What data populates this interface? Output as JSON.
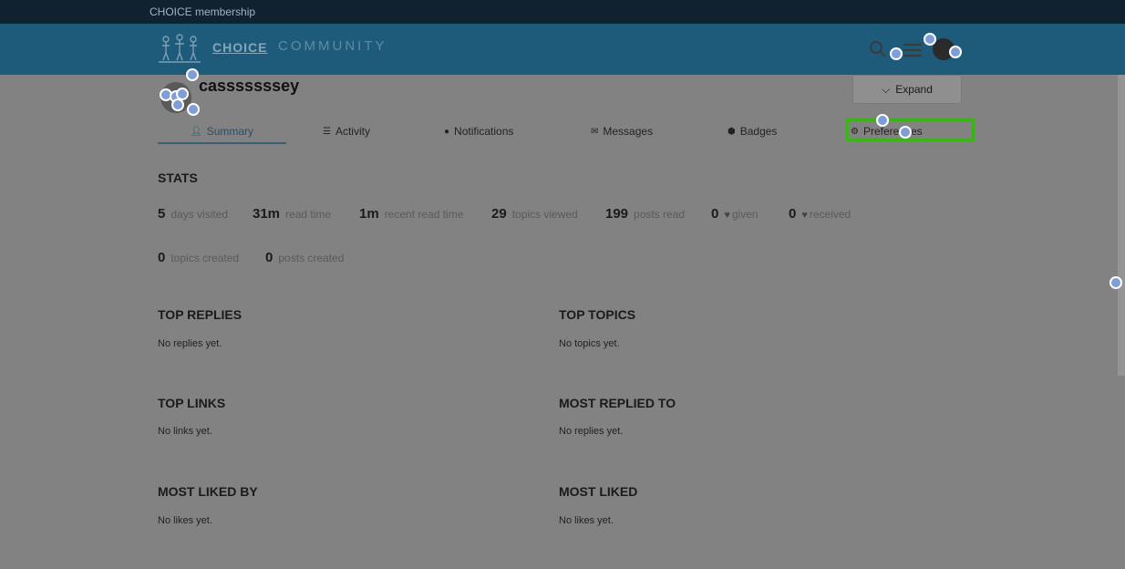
{
  "topbar": {
    "membership": "CHOICE membership"
  },
  "header": {
    "brand_choice": "CHOICE",
    "brand_community": "COMMUNITY"
  },
  "profile": {
    "username": "casssssssey",
    "expand_label": "Expand"
  },
  "tabs": [
    {
      "label": "Summary",
      "icon": "user-icon"
    },
    {
      "label": "Activity",
      "icon": "list-icon"
    },
    {
      "label": "Notifications",
      "icon": "bell-icon"
    },
    {
      "label": "Messages",
      "icon": "envelope-icon"
    },
    {
      "label": "Badges",
      "icon": "badge-icon"
    },
    {
      "label": "Preferences",
      "icon": "gear-icon"
    }
  ],
  "stats": {
    "title": "STATS",
    "items": [
      {
        "value": "5",
        "label": "days visited"
      },
      {
        "value": "31m",
        "label": "read time"
      },
      {
        "value": "1m",
        "label": "recent read time"
      },
      {
        "value": "29",
        "label": "topics viewed"
      },
      {
        "value": "199",
        "label": "posts read"
      },
      {
        "value": "0",
        "label": "given"
      },
      {
        "value": "0",
        "label": "received"
      },
      {
        "value": "0",
        "label": "topics created"
      },
      {
        "value": "0",
        "label": "posts created"
      }
    ]
  },
  "sections": {
    "top_replies": {
      "title": "TOP REPLIES",
      "empty": "No replies yet."
    },
    "top_topics": {
      "title": "TOP TOPICS",
      "empty": "No topics yet."
    },
    "top_links": {
      "title": "TOP LINKS",
      "empty": "No links yet."
    },
    "most_replied_to": {
      "title": "MOST REPLIED TO",
      "empty": "No replies yet."
    },
    "most_liked_by": {
      "title": "MOST LIKED BY",
      "empty": "No likes yet."
    },
    "most_liked": {
      "title": "MOST LIKED",
      "empty": "No likes yet."
    }
  },
  "colors": {
    "header_bg": "#1e5b7a",
    "topbar_bg": "#10222f",
    "overlay_bg": "#828282",
    "highlight": "#3cb318",
    "click_marker": "#7f9dd6"
  }
}
